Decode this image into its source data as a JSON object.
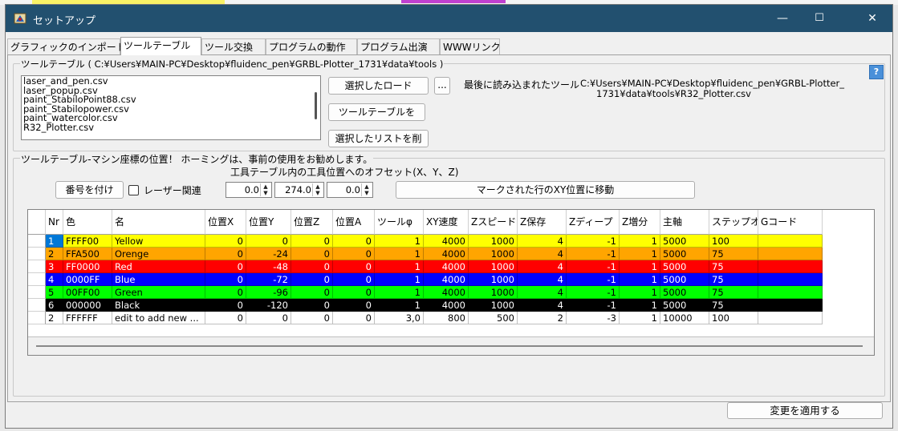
{
  "window": {
    "title": "セットアップ",
    "controls": {
      "minimize": "—",
      "maximize": "☐",
      "close": "✕"
    }
  },
  "tabs": [
    {
      "label": "グラフィックのインポート",
      "active": false
    },
    {
      "label": "ツールテーブル",
      "active": true
    },
    {
      "label": "ツール交換",
      "active": false
    },
    {
      "label": "プログラムの動作",
      "active": false
    },
    {
      "label": "プログラム出演",
      "active": false
    },
    {
      "label": "WWWリンク",
      "active": false
    }
  ],
  "tooltable_group": {
    "title": "ツールテーブル ( C:¥Users¥MAIN-PC¥Desktop¥fluidenc_pen¥GRBL-Plotter_1731¥data¥tools )",
    "files": [
      "laser_and_pen.csv",
      "laser_popup.csv",
      "paint_StabiloPoint88.csv",
      "paint_Stabilopower.csv",
      "paint_watercolor.csv",
      "R32_Plotter.csv"
    ],
    "load_button": "選択したロード",
    "browse_button": "...",
    "save_button": "ツールテーブルを",
    "delete_button": "選択したリストを削",
    "last_loaded_label": "最後に読み込まれたツール",
    "last_loaded_line1": "C:¥Users¥MAIN-PC¥Desktop¥fluidenc_pen¥GRBL-Plotter_",
    "last_loaded_line2": "1731¥data¥tools¥R32_Plotter.csv",
    "help": "?"
  },
  "position_group": {
    "title": "ツールテーブル-マシン座標の位置！ ホーミングは、事前の使用をお勧めします。",
    "offset_label": "工具テーブル内の工具位置へのオフセット(X、Y、Z)",
    "number_button": "番号を付け",
    "laser_label": "レーザー関連",
    "offset_x": "0.0",
    "offset_y": "274.0",
    "offset_z": "0.0",
    "move_button": "マークされた行のXY位置に移動"
  },
  "table": {
    "headers": [
      "Nr",
      "色",
      "名",
      "位置X",
      "位置Y",
      "位置Z",
      "位置A",
      "ツールφ",
      "XY速度",
      "Zスピード",
      "Z保存",
      "Zディープ",
      "Z増分",
      "主軸",
      "ステップオーバー",
      "Gコード"
    ],
    "rows": [
      {
        "nr": "1",
        "color": "FFFF00",
        "name": "Yellow",
        "x": "0",
        "y": "0",
        "z": "0",
        "a": "0",
        "dia": "1",
        "xy": "4000",
        "zs": "1000",
        "zsave": "4",
        "zdeep": "-1",
        "zinc": "1",
        "spindle": "5000",
        "step": "100",
        "gcode": "",
        "bg": "#ffff00",
        "fg": "#000000"
      },
      {
        "nr": "2",
        "color": "FFA500",
        "name": "Orenge",
        "x": "0",
        "y": "-24",
        "z": "0",
        "a": "0",
        "dia": "1",
        "xy": "4000",
        "zs": "1000",
        "zsave": "4",
        "zdeep": "-1",
        "zinc": "1",
        "spindle": "5000",
        "step": "75",
        "gcode": "",
        "bg": "#ffa500",
        "fg": "#000000"
      },
      {
        "nr": "3",
        "color": "FF0000",
        "name": "Red",
        "x": "0",
        "y": "-48",
        "z": "0",
        "a": "0",
        "dia": "1",
        "xy": "4000",
        "zs": "1000",
        "zsave": "4",
        "zdeep": "-1",
        "zinc": "1",
        "spindle": "5000",
        "step": "75",
        "gcode": "",
        "bg": "#ff0000",
        "fg": "#ffffff"
      },
      {
        "nr": "4",
        "color": "0000FF",
        "name": "Blue",
        "x": "0",
        "y": "-72",
        "z": "0",
        "a": "0",
        "dia": "1",
        "xy": "4000",
        "zs": "1000",
        "zsave": "4",
        "zdeep": "-1",
        "zinc": "1",
        "spindle": "5000",
        "step": "75",
        "gcode": "",
        "bg": "#0000ff",
        "fg": "#ffffff"
      },
      {
        "nr": "5",
        "color": "00FF00",
        "name": "Green",
        "x": "0",
        "y": "-96",
        "z": "0",
        "a": "0",
        "dia": "1",
        "xy": "4000",
        "zs": "1000",
        "zsave": "4",
        "zdeep": "-1",
        "zinc": "1",
        "spindle": "5000",
        "step": "75",
        "gcode": "",
        "bg": "#00ff00",
        "fg": "#000000"
      },
      {
        "nr": "6",
        "color": "000000",
        "name": "Black",
        "x": "0",
        "y": "-120",
        "z": "0",
        "a": "0",
        "dia": "1",
        "xy": "4000",
        "zs": "1000",
        "zsave": "4",
        "zdeep": "-1",
        "zinc": "1",
        "spindle": "5000",
        "step": "75",
        "gcode": "",
        "bg": "#000000",
        "fg": "#ffffff"
      },
      {
        "nr": "2",
        "color": "FFFFFF",
        "name": "edit to add new ...",
        "x": "0",
        "y": "0",
        "z": "0",
        "a": "0",
        "dia": "3,0",
        "xy": "800",
        "zs": "500",
        "zsave": "2",
        "zdeep": "-3",
        "zinc": "1",
        "spindle": "10000",
        "step": "100",
        "gcode": "",
        "bg": "#ffffff",
        "fg": "#000000"
      }
    ]
  },
  "apply_button": "変更を適用する"
}
